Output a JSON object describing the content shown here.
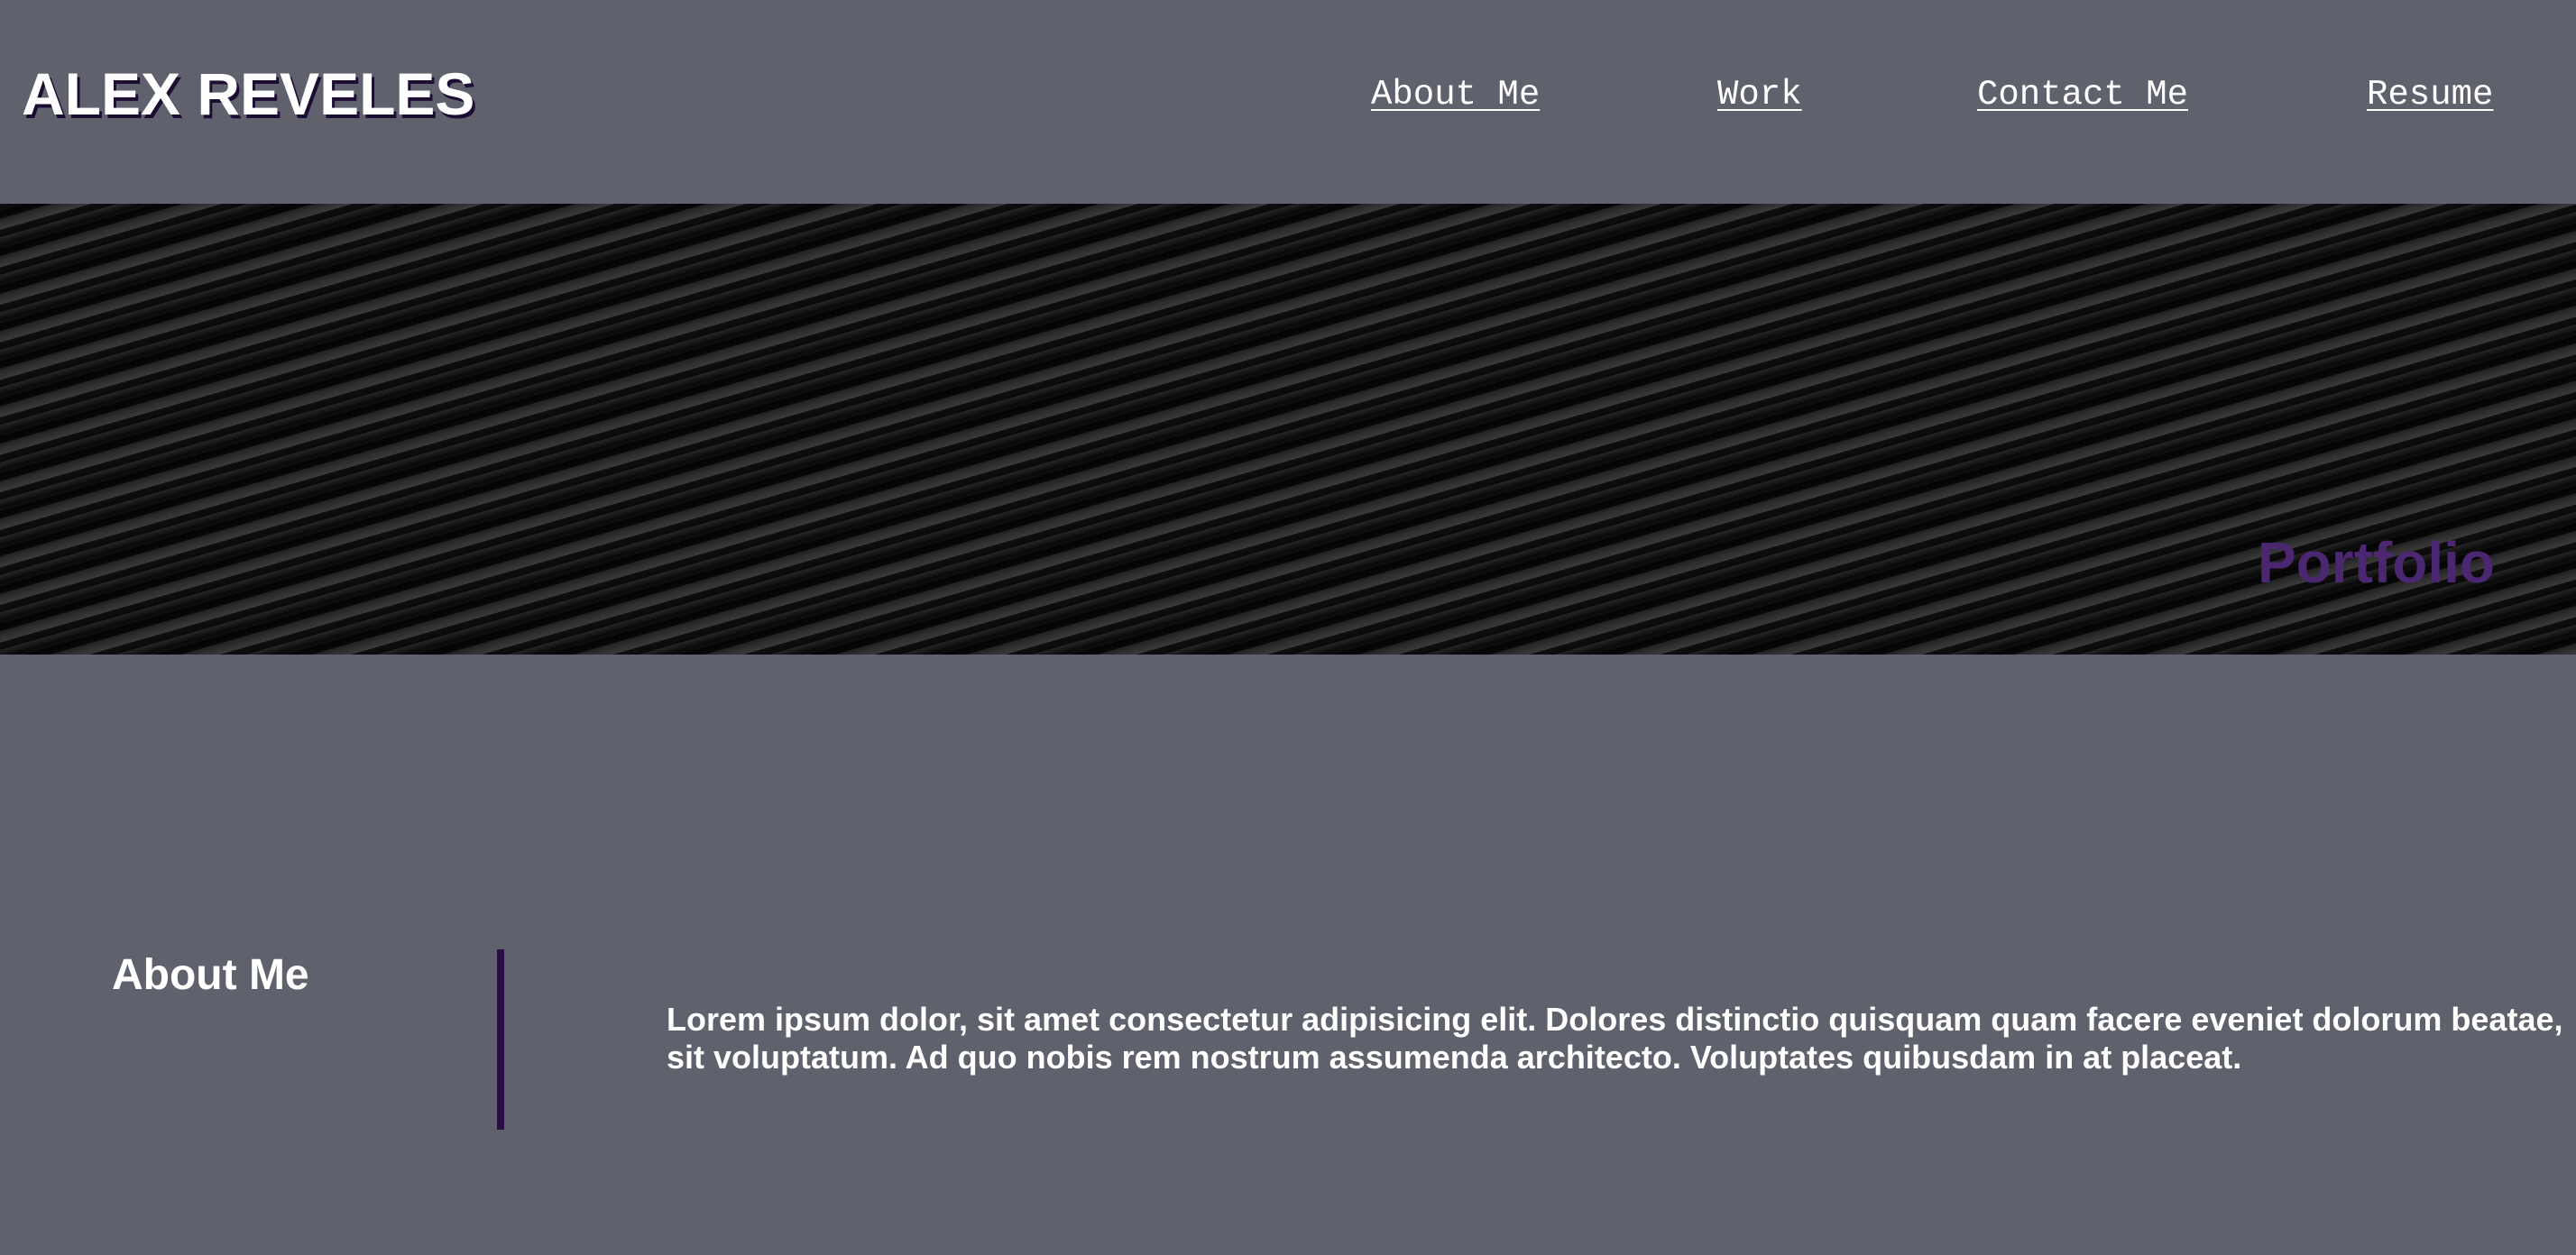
{
  "header": {
    "site_name": "ALEX REVELES",
    "nav": [
      {
        "label": "About Me"
      },
      {
        "label": "Work"
      },
      {
        "label": "Contact Me"
      },
      {
        "label": "Resume"
      }
    ]
  },
  "hero": {
    "title": "Portfolio"
  },
  "about": {
    "heading": "About Me",
    "body": "Lorem ipsum dolor, sit amet consectetur adipisicing elit. Dolores distinctio quisquam quam facere eveniet dolorum beatae, sit voluptatum. Ad quo nobis rem nostrum assumenda architecto. Voluptates quibusdam in at placeat."
  },
  "colors": {
    "page_background": "#5f626c",
    "accent_purple": "#4a2770",
    "divider_purple": "#2a0c47",
    "text": "#ffffff"
  }
}
